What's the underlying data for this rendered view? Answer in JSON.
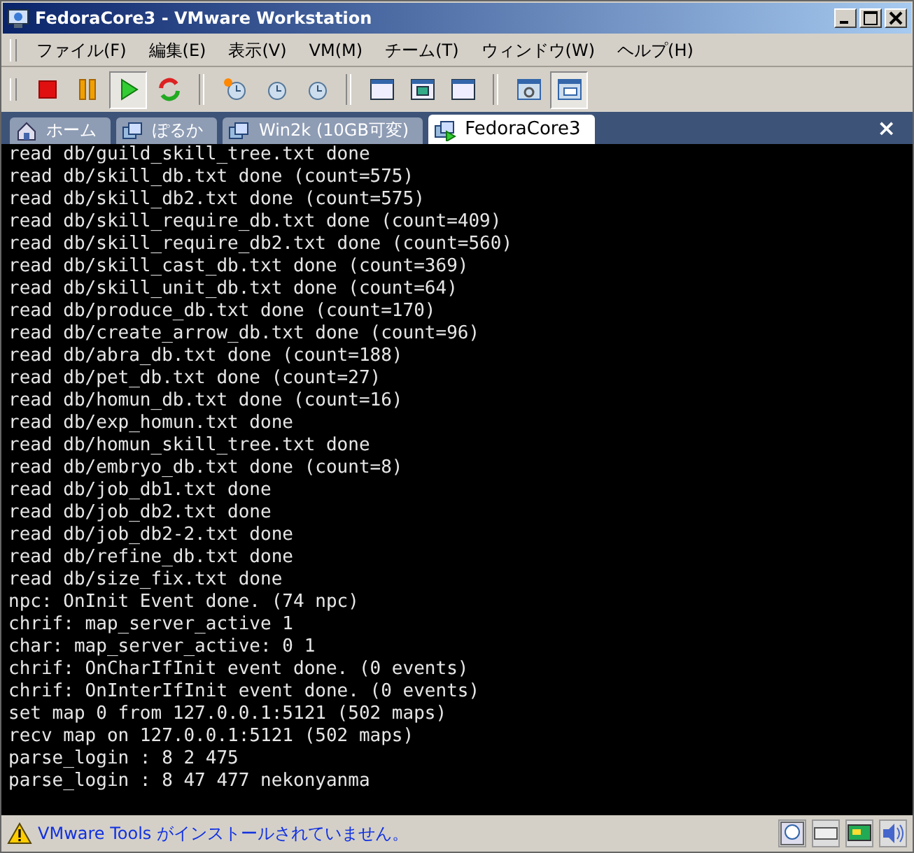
{
  "window": {
    "title": "FedoraCore3 - VMware Workstation"
  },
  "menu": [
    "ファイル(F)",
    "編集(E)",
    "表示(V)",
    "VM(M)",
    "チーム(T)",
    "ウィンドウ(W)",
    "ヘルプ(H)"
  ],
  "toolbar": [
    {
      "kind": "stop",
      "pressed": false
    },
    {
      "kind": "pause",
      "pressed": false
    },
    {
      "kind": "play",
      "pressed": true
    },
    {
      "kind": "reset",
      "pressed": false
    },
    {
      "kind": "sep"
    },
    {
      "kind": "snapshot",
      "pressed": false
    },
    {
      "kind": "revert",
      "pressed": false
    },
    {
      "kind": "manager",
      "pressed": false
    },
    {
      "kind": "sep"
    },
    {
      "kind": "sidebar",
      "pressed": false
    },
    {
      "kind": "fullscreen",
      "pressed": false
    },
    {
      "kind": "quickswitch",
      "pressed": false
    },
    {
      "kind": "sep"
    },
    {
      "kind": "settings",
      "pressed": false
    },
    {
      "kind": "summary",
      "pressed": true
    }
  ],
  "tabs": [
    {
      "label": "ホーム",
      "kind": "home",
      "selected": false
    },
    {
      "label": "ぽるか",
      "kind": "vm",
      "selected": false
    },
    {
      "label": "Win2k (10GB可変)",
      "kind": "vm",
      "selected": false
    },
    {
      "label": "FedoraCore3",
      "kind": "vm-running",
      "selected": true
    }
  ],
  "tab_close": "×",
  "console": [
    "read db/guild_skill_tree.txt done",
    "read db/skill_db.txt done (count=575)",
    "read db/skill_db2.txt done (count=575)",
    "read db/skill_require_db.txt done (count=409)",
    "read db/skill_require_db2.txt done (count=560)",
    "read db/skill_cast_db.txt done (count=369)",
    "read db/skill_unit_db.txt done (count=64)",
    "read db/produce_db.txt done (count=170)",
    "read db/create_arrow_db.txt done (count=96)",
    "read db/abra_db.txt done (count=188)",
    "read db/pet_db.txt done (count=27)",
    "read db/homun_db.txt done (count=16)",
    "read db/exp_homun.txt done",
    "read db/homun_skill_tree.txt done",
    "read db/embryo_db.txt done (count=8)",
    "read db/job_db1.txt done",
    "read db/job_db2.txt done",
    "read db/job_db2-2.txt done",
    "read db/refine_db.txt done",
    "read db/size_fix.txt done",
    "npc: OnInit Event done. (74 npc)",
    "chrif: map_server_active 1",
    "char: map_server_active: 0 1",
    "chrif: OnCharIfInit event done. (0 events)",
    "chrif: OnInterIfInit event done. (0 events)",
    "set map 0 from 127.0.0.1:5121 (502 maps)",
    "recv map on 127.0.0.1:5121 (502 maps)",
    "parse_login : 8 2 475",
    "parse_login : 8 47 477 nekonyanma"
  ],
  "status_bar": {
    "message": "VMware Tools がインストールされていません。"
  }
}
